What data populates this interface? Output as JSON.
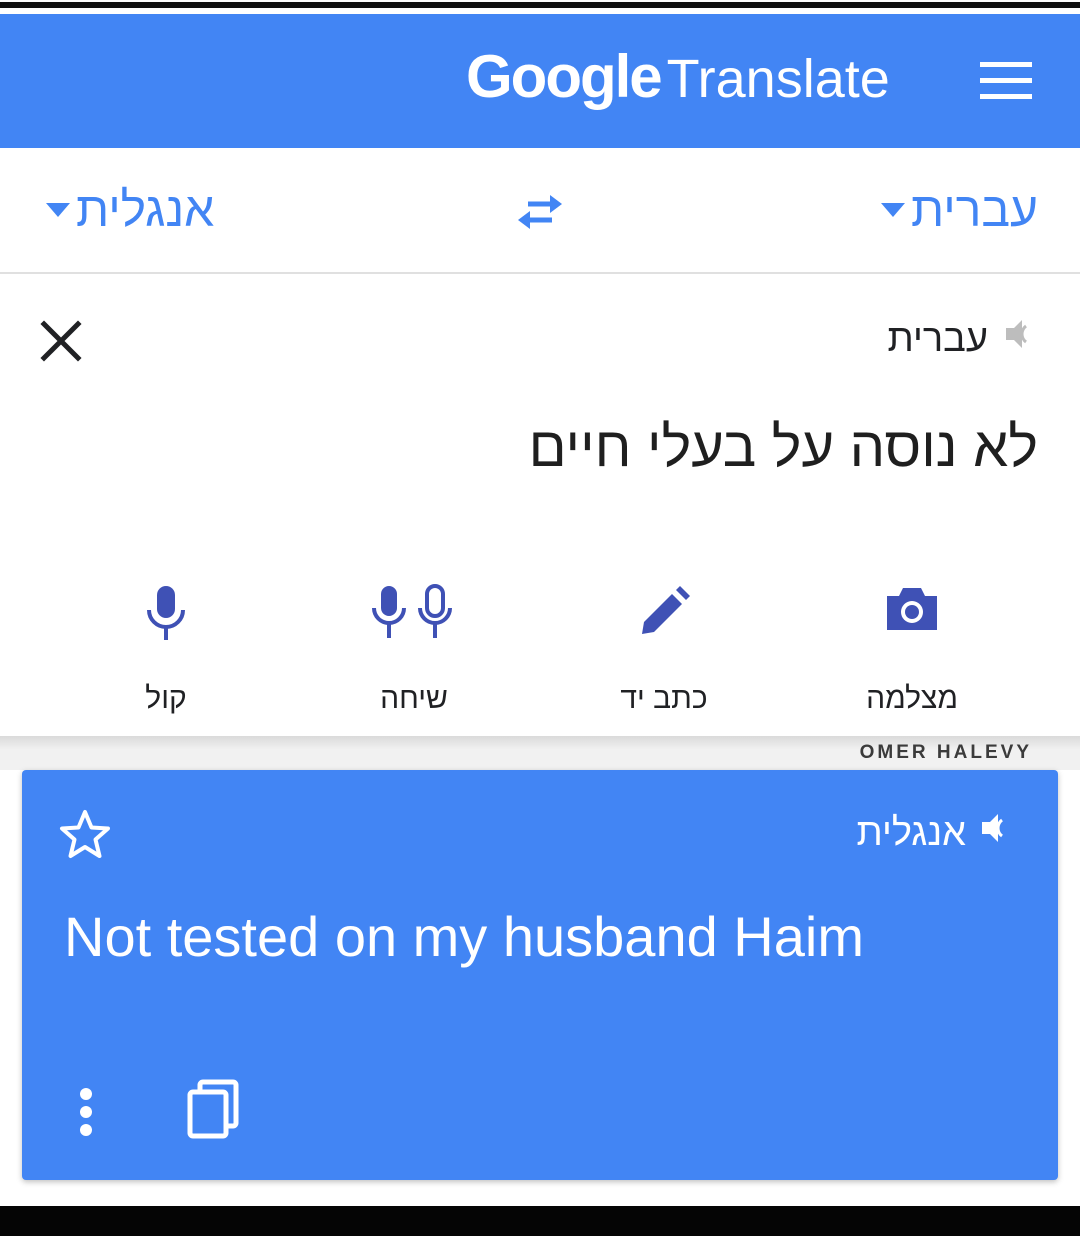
{
  "app": {
    "brand_google": "Google",
    "brand_translate": "Translate",
    "accent_color": "#4285f4"
  },
  "languages": {
    "target": "אנגלית",
    "source": "עברית"
  },
  "input": {
    "language_label": "עברית",
    "text": "לא נוסה על בעלי חיים"
  },
  "tools": [
    {
      "label": "קול",
      "icon": "mic-icon"
    },
    {
      "label": "שיחה",
      "icon": "conversation-icon"
    },
    {
      "label": "כתב יד",
      "icon": "pen-icon"
    },
    {
      "label": "מצלמה",
      "icon": "camera-icon"
    }
  ],
  "watermark": "OMER HALEVY",
  "output": {
    "language_label": "אנגלית",
    "text": "Not tested on my husband Haim"
  }
}
